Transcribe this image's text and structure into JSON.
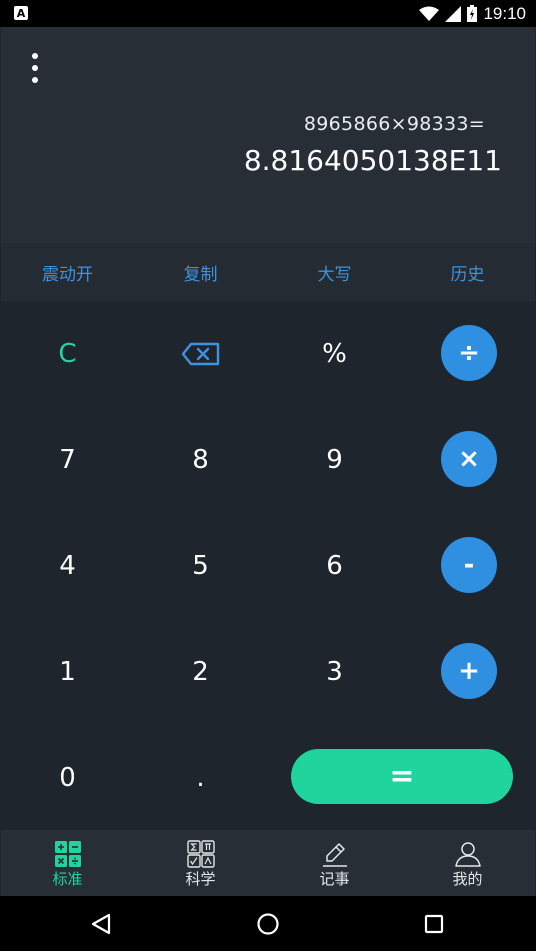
{
  "status_bar": {
    "notification_icon": "A",
    "time": "19:10"
  },
  "display": {
    "expression": "8965866×98333=",
    "result": "8.8164050138E11"
  },
  "function_row": [
    {
      "label": "震动开"
    },
    {
      "label": "复制"
    },
    {
      "label": "大写"
    },
    {
      "label": "历史"
    }
  ],
  "keys": {
    "clear": "C",
    "percent": "%",
    "divide": "÷",
    "seven": "7",
    "eight": "8",
    "nine": "9",
    "multiply": "×",
    "four": "4",
    "five": "5",
    "six": "6",
    "minus": "-",
    "one": "1",
    "two": "2",
    "three": "3",
    "plus": "+",
    "zero": "0",
    "dot": ".",
    "equals": "="
  },
  "tabs": [
    {
      "label": "标准",
      "icon": "standard-calculator-icon",
      "active": true
    },
    {
      "label": "科学",
      "icon": "scientific-calculator-icon",
      "active": false
    },
    {
      "label": "记事",
      "icon": "note-pencil-icon",
      "active": false
    },
    {
      "label": "我的",
      "icon": "user-profile-icon",
      "active": false
    }
  ],
  "colors": {
    "accent_blue": "#2f8fe0",
    "accent_green": "#1fd59d",
    "function_text": "#3d93df",
    "background": "#1f252c"
  }
}
